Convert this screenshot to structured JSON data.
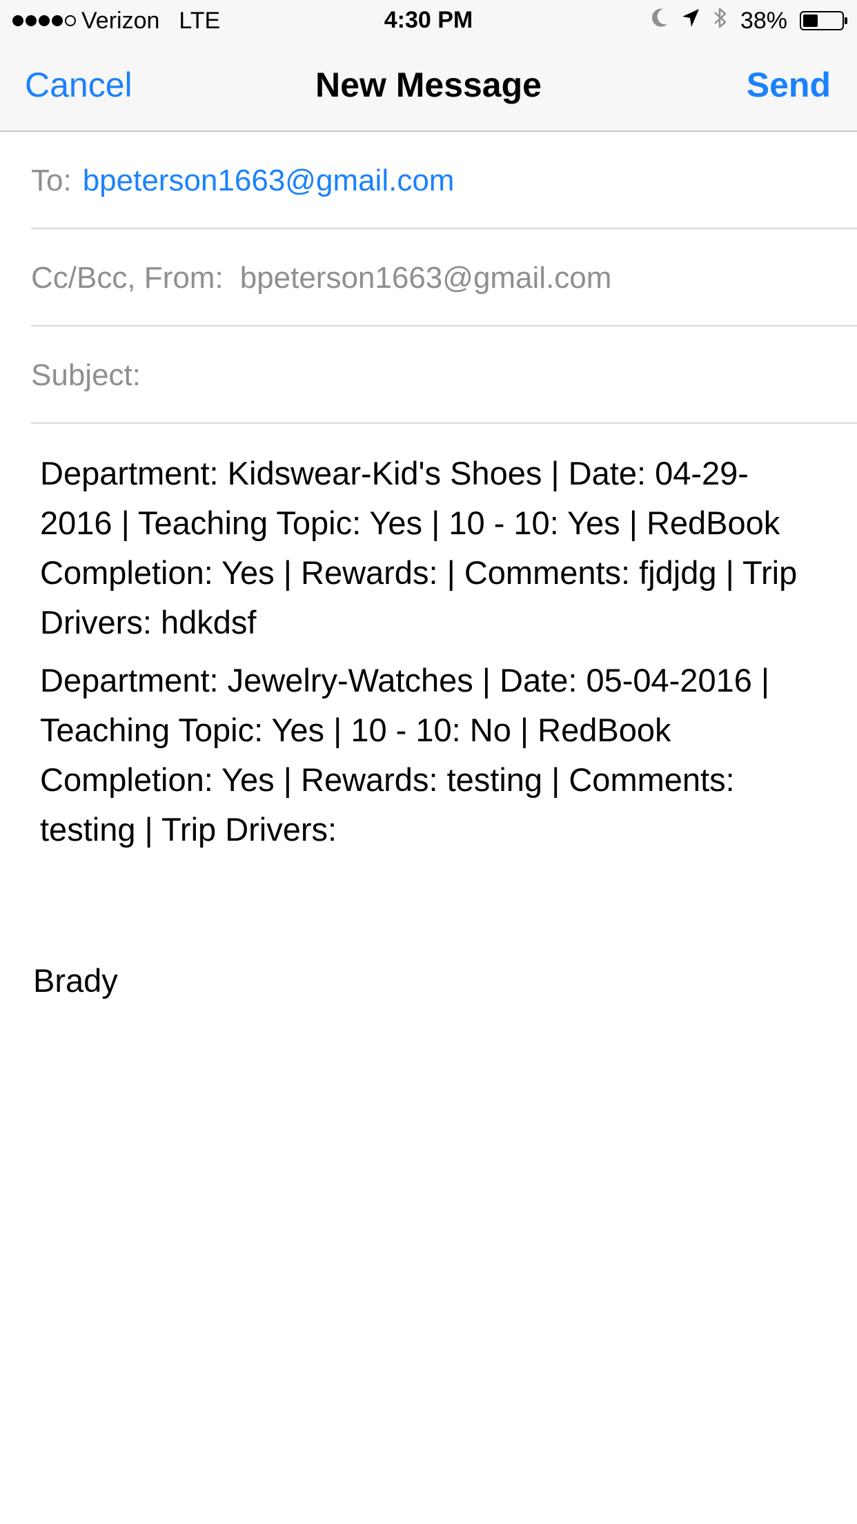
{
  "status_bar": {
    "signal_bars_filled": 4,
    "signal_bars_total": 5,
    "carrier": "Verizon",
    "network": "LTE",
    "time": "4:30 PM",
    "battery_percent_text": "38%",
    "battery_level": 0.38,
    "icons": [
      "moon-icon",
      "location-arrow-icon",
      "bluetooth-icon",
      "battery-icon"
    ]
  },
  "nav": {
    "cancel_label": "Cancel",
    "title": "New Message",
    "send_label": "Send"
  },
  "fields": {
    "to_label": "To:",
    "to_value": "bpeterson1663@gmail.com",
    "cc_from_label": "Cc/Bcc, From:",
    "from_value": "bpeterson1663@gmail.com",
    "subject_label": "Subject:",
    "subject_value": ""
  },
  "body": {
    "paragraphs": [
      "Department: Kidswear-Kid's Shoes | Date: 04-29-2016 | Teaching Topic: Yes | 10 - 10: Yes | RedBook Completion: Yes | Rewards: | Comments: fjdjdg | Trip Drivers: hdkdsf",
      "Department: Jewelry-Watches | Date: 05-04-2016 | Teaching Topic: Yes | 10 - 10: No | RedBook Completion: Yes | Rewards: testing | Comments: testing | Trip Drivers:"
    ],
    "signature": "Brady"
  },
  "colors": {
    "accent": "#1a82fb",
    "secondary_text": "#8e8e93",
    "bar_background": "#f7f7f7",
    "separator": "#d9d9dc"
  }
}
